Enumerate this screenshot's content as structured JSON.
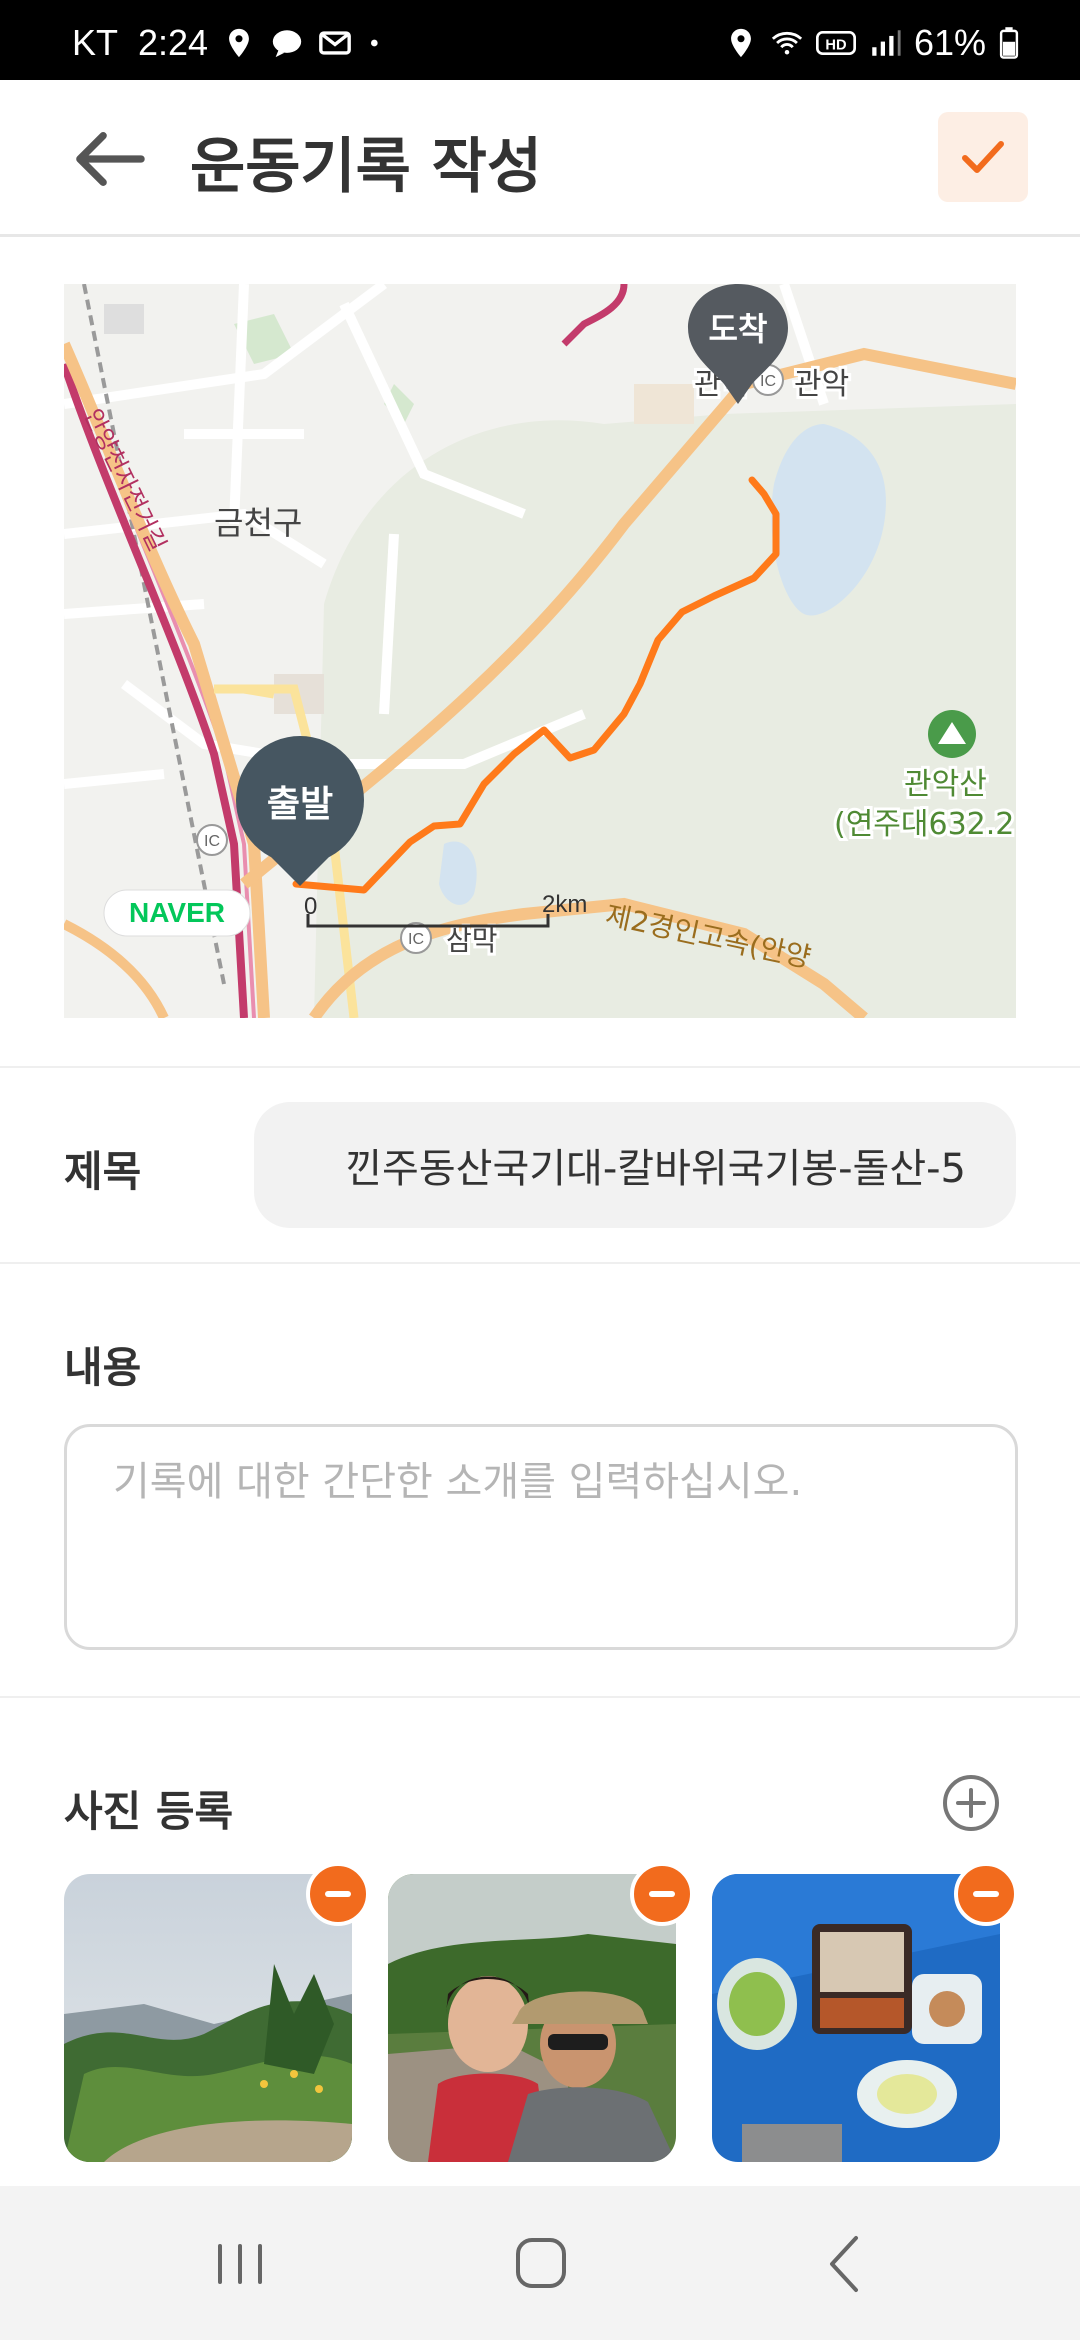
{
  "status_bar": {
    "carrier": "KT",
    "time": "2:24",
    "battery": "61%",
    "icons_left": [
      "location-icon",
      "talk-icon",
      "mail-icon",
      "dot-icon"
    ],
    "icons_right": [
      "location-icon",
      "wifi-icon",
      "hd-icon",
      "signal-icon",
      "battery-icon"
    ]
  },
  "header": {
    "title": "운동기록 작성",
    "back_icon": "arrow-left-icon",
    "confirm_icon": "check-icon",
    "accent_color": "#f26b1d"
  },
  "map": {
    "start_label": "출발",
    "end_label": "도착",
    "places": [
      "금천구",
      "관악",
      "관악",
      "관악산",
      "(연주대632.2",
      "삼막",
      "제2경인고속(안양",
      "안양천자전거길"
    ],
    "ic_badge": "IC",
    "brand": "NAVER",
    "scale_zero": "0",
    "scale_label": "2km",
    "route_color": "#ff7a1a"
  },
  "form": {
    "title_label": "제목",
    "title_value": "낀주동산국기대-칼바위국기봉-돌산-5",
    "content_label": "내용",
    "content_placeholder": "기록에 대한 간단한 소개를 입력하십시오.",
    "photo_label": "사진 등록",
    "photos": [
      "mountain-view-photo",
      "hikers-selfie-photo",
      "picnic-lunch-photo"
    ]
  },
  "nav_bar": {
    "buttons": [
      "recent-apps-icon",
      "home-icon",
      "back-icon"
    ]
  }
}
